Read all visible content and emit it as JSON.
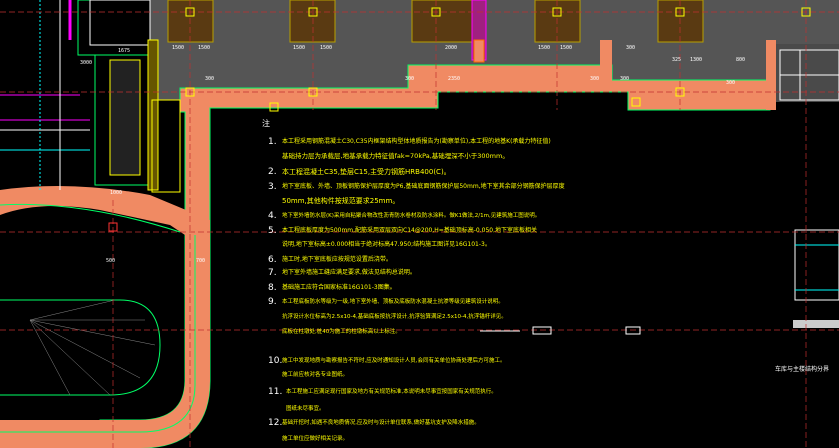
{
  "drawing": {
    "notes_title": "注",
    "note_numbers": [
      "1.",
      "2.",
      "3.",
      "4.",
      "5.",
      "6.",
      "7.",
      "8.",
      "9.",
      "10.",
      "11.",
      "12."
    ],
    "notes": [
      "本工程采用钢筋混凝土C30,C35内框架结构型体地质报告为(勘察单位),本工程的地基K(承载力特征值)",
      "基础持力层为承载层,地基承载力特征值fak=70kPa,基础埋深不小于300mm。",
      "本工程混凝土C35,垫层C15,主受力钢筋HRB400(C)。",
      "地下室底板、外墙、顶板钢筋保护层厚度为P6,基础底面钢筋保护层50mm,地下室其余部分钢筋保护层厚度",
      "50mm,其他构件按规范要求25mm。",
      "地下室外墙防水层(K)采用自粘聚合物改性沥青防水卷材及防水涂料。做K1做法,2/1m,见建筑施工图说明。",
      "本工程底板厚度为500mm,配筋采用双层双向C14@200,H=基础顶标高-0.050,地下室底板相关",
      "说明,地下室标高±0.000相当于绝对标高47.950;结构施工图详见16G101-3。",
      "施工时,地下室底板应按规范设置后浇带。",
      "地下室外墙施工缝应满足要求,做法见结构总说明。",
      "基础施工应符合国家标准16G101-3图集。",
      "本工程底板防水等级为一级,地下室外墙、顶板及底板防水混凝土抗渗等级见建筑设计说明。",
      "抗浮设计水位标高为2.5x10-4,基础底板按抗浮设计,抗浮验算满足2.5x10-4,抗浮锚杆详见。",
      "底板在柱墩处,桩40为施工的柱墩标高以上标注。",
      "施工中发现地质与勘察报告不符时,应及时通知设计人员,会同有关单位协商处理后方可施工。",
      "施工前应核对各专业图纸。",
      "本工程施工应满足现行国家及地方有关规范标准,本说明未尽事宜按国家有关规范执行。",
      "图纸未尽事宜。",
      "基础开挖时,如遇不良地质情况,应及时与设计单位联系,做好基坑支护及降水措施。",
      "施工单位应做好相关记录。"
    ],
    "dims": [
      "1500",
      "1500",
      "1500",
      "1500",
      "2000",
      "2350",
      "1500",
      "1500",
      "300",
      "300",
      "325",
      "1300",
      "800",
      "300",
      "300",
      "1000",
      "500",
      "700",
      "1675",
      "3000",
      "300",
      "300"
    ],
    "side_label": "车库与主楼结构分界",
    "colors": {
      "background": "#000000",
      "slab_gray": "#555555",
      "salmon_border": "#f07f5a",
      "wall_line": "#00ff00",
      "column_fill": "#553a18",
      "column_frame": "#b0a000",
      "magenta": "#ff00ff",
      "gridline": "#d23a3a",
      "note_text": "#ffff00"
    }
  }
}
